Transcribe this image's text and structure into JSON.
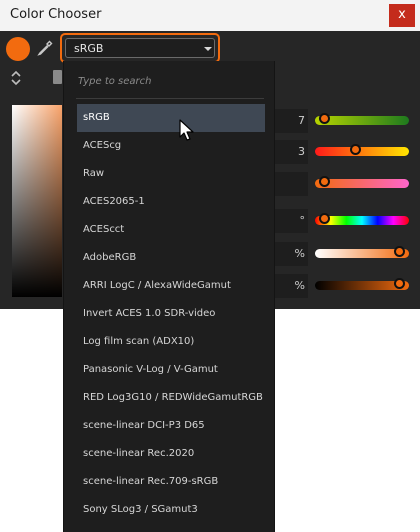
{
  "window": {
    "title": "Color Chooser",
    "close_glyph": "x"
  },
  "colors": {
    "current_color": "#f26b0f",
    "focus_ring": "#f26b0f",
    "selected_option_bg": "#3f4854",
    "close_button": "#c42b1c"
  },
  "toolbar": {
    "colorspace_value": "sRGB",
    "eyedropper_icon": "eyedropper-icon",
    "mode_toggle_icon": "up-down-arrows-icon",
    "square_icon": "square-icon"
  },
  "value_fields": [
    {
      "text": "7"
    },
    {
      "text": "3"
    },
    {
      "text": ""
    },
    {
      "text": "°"
    },
    {
      "text": "%"
    },
    {
      "text": "%"
    }
  ],
  "sliders": [
    {
      "name": "green-slider",
      "level": 0.05
    },
    {
      "name": "red-slider",
      "level": 0.42
    },
    {
      "name": "orange-slider",
      "level": 0.05
    },
    {
      "name": "hue-slider",
      "level": 0.05
    },
    {
      "name": "saturation-slider",
      "level": 0.95
    },
    {
      "name": "value-slider",
      "level": 0.95
    }
  ],
  "dropdown": {
    "search_placeholder": "Type to search",
    "selected_index": 0,
    "options": [
      "sRGB",
      "ACEScg",
      "Raw",
      "ACES2065-1",
      "ACEScct",
      "AdobeRGB",
      "ARRI LogC / AlexaWideGamut",
      "Invert ACES 1.0 SDR-video",
      "Log film scan (ADX10)",
      "Panasonic V-Log / V-Gamut",
      "RED Log3G10 / REDWideGamutRGB",
      "scene-linear DCI-P3 D65",
      "scene-linear Rec.2020",
      "scene-linear Rec.709-sRGB",
      "Sony SLog3 / SGamut3"
    ]
  }
}
